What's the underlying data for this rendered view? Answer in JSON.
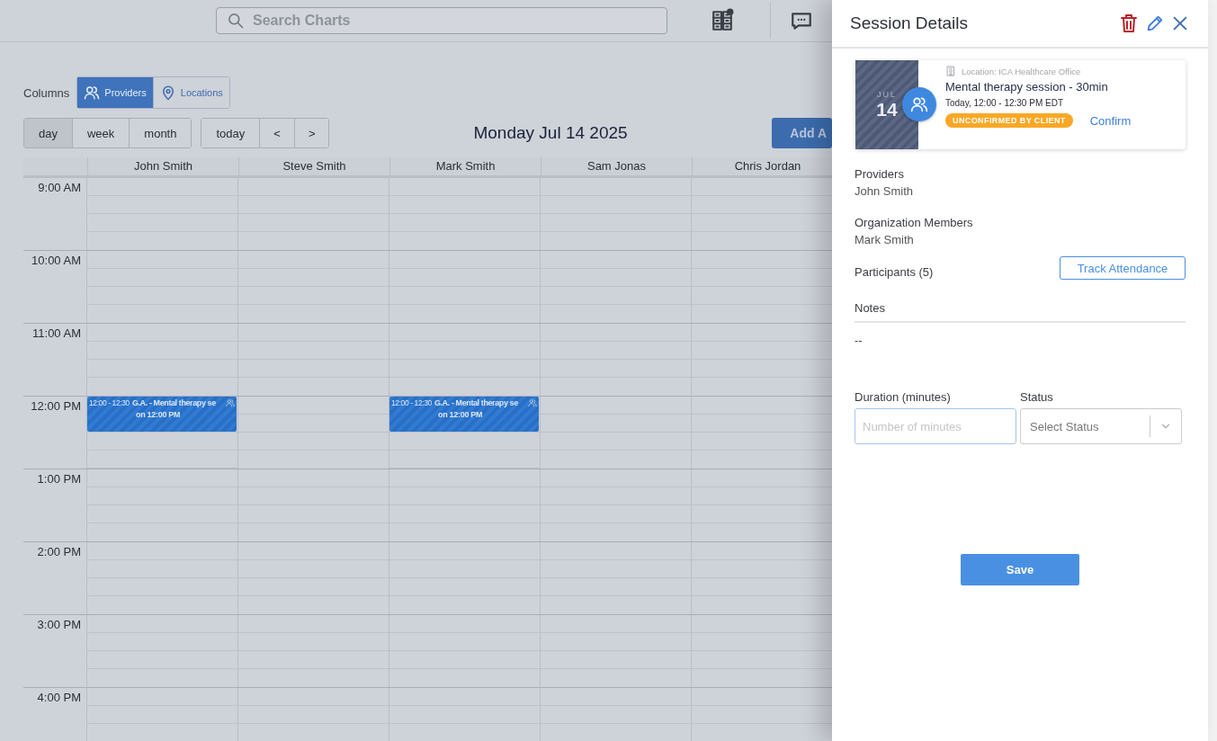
{
  "topbar": {
    "search": {
      "placeholder": "Search Charts"
    }
  },
  "columns_toggle": {
    "label": "Columns",
    "options": [
      {
        "label": "Providers",
        "kind": "people",
        "selected": true
      },
      {
        "label": "Locations",
        "kind": "pin",
        "selected": false
      }
    ]
  },
  "view_buttons": [
    {
      "label": "day",
      "selected": true
    },
    {
      "label": "week",
      "selected": false
    },
    {
      "label": "month",
      "selected": false
    }
  ],
  "nav_buttons": [
    "today",
    "<",
    ">"
  ],
  "date_title": "Monday Jul 14 2025",
  "add_button": "Add A",
  "calendar": {
    "columns": [
      "John Smith",
      "Steve Smith",
      "Mark Smith",
      "Sam Jonas",
      "Chris Jordan"
    ],
    "hours": [
      {
        "label": "9:00 AM"
      },
      {
        "label": "10:00 AM"
      },
      {
        "label": "11:00 AM"
      },
      {
        "label": "12:00 PM",
        "cells": [
          {
            "kind": "event",
            "time": "12:00 - 12:30",
            "title": "G.A. - Mental therapy se",
            "line2": "on 12:00 PM"
          },
          {
            "kind": "empty"
          },
          {
            "kind": "event",
            "time": "12:00 - 12:30",
            "title": "G.A. - Mental therapy se",
            "line2": "on 12:00 PM"
          },
          {
            "kind": "empty"
          },
          {
            "kind": "empty"
          }
        ]
      },
      {
        "label": "1:00 PM"
      },
      {
        "label": "2:00 PM"
      },
      {
        "label": "3:00 PM"
      },
      {
        "label": "4:00 PM"
      }
    ]
  },
  "panel": {
    "title": "Session Details",
    "card": {
      "month": "JUL",
      "day": "14",
      "location": "Location: ICA Healthcare Office",
      "title": "Mental therapy session - 30min",
      "time": "Today, 12:00 - 12:30 PM EDT",
      "badge": "UNCONFIRMED BY CLIENT",
      "confirm": "Confirm"
    },
    "providers": {
      "label": "Providers",
      "value": "John Smith"
    },
    "members": {
      "label": "Organization Members",
      "value": "Mark Smith"
    },
    "participants": {
      "label": "Participants (5)",
      "button": "Track Attendance"
    },
    "notes": {
      "label": "Notes",
      "value": "--"
    },
    "duration": {
      "label": "Duration (minutes)",
      "placeholder": "Number of minutes"
    },
    "status": {
      "label": "Status",
      "placeholder": "Select Status"
    },
    "save": "Save"
  }
}
